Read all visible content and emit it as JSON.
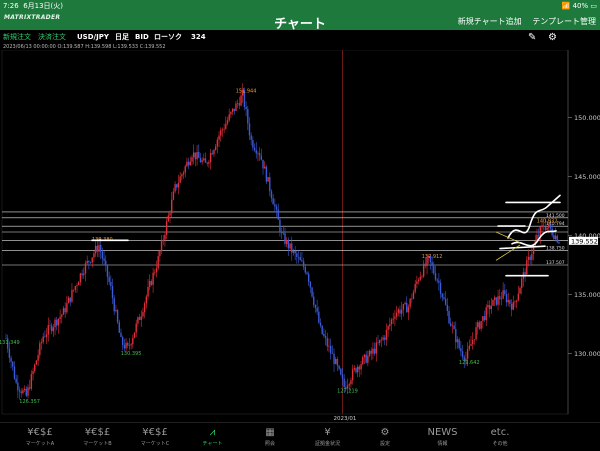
{
  "status": {
    "time": "7:26",
    "date": "6月13日(火)",
    "battery": "40%"
  },
  "header": {
    "logo": "MATRIXTRADER",
    "title": "チャート",
    "actions": [
      "新規チャート追加",
      "テンプレート管理"
    ]
  },
  "toolbar": {
    "new_order": "新規注文",
    "settle_order": "決済注文",
    "pair": "USD/JPY",
    "timeframe": "日足",
    "side": "BID",
    "chart_type": "ローソク",
    "bars": "324"
  },
  "ohlc": "2023/06/13 00:00:00  O:139.587  H:139.598  L:139.533  C:139.552",
  "chart_data": {
    "type": "candlestick",
    "pair": "USD/JPY",
    "y_ticks": [
      130.0,
      135.0,
      140.0,
      145.0,
      150.0
    ],
    "y_tick_labels": [
      "130.000",
      "135.000",
      "140.000",
      "145.000",
      "150.000"
    ],
    "x_labels": [
      "2023/01"
    ],
    "price_marks": [
      {
        "label": "151.944",
        "type": "high",
        "value": 151.944
      },
      {
        "label": "139.380",
        "type": "high",
        "value": 139.38
      },
      {
        "label": "137.912",
        "type": "high",
        "value": 137.912
      },
      {
        "label": "140.932",
        "type": "high",
        "value": 140.932
      },
      {
        "label": "131.349",
        "type": "low",
        "value": 131.349
      },
      {
        "label": "126.357",
        "type": "low",
        "value": 126.357
      },
      {
        "label": "130.395",
        "type": "low",
        "value": 130.395
      },
      {
        "label": "127.219",
        "type": "low",
        "value": 127.219
      },
      {
        "label": "129.642",
        "type": "low",
        "value": 129.642
      }
    ],
    "current_price": "139.552",
    "horizontal_lines": [
      {
        "label": "",
        "value": 142.0
      },
      {
        "label": "141.500",
        "value": 141.5
      },
      {
        "label": "140.794",
        "value": 140.794
      },
      {
        "label": "",
        "value": 140.3
      },
      {
        "label": "",
        "value": 139.6
      },
      {
        "label": "138.750",
        "value": 138.75
      },
      {
        "label": "137.507",
        "value": 137.507
      }
    ],
    "waypoints": [
      [
        0,
        131.3
      ],
      [
        6,
        127.5
      ],
      [
        12,
        126.4
      ],
      [
        22,
        131.5
      ],
      [
        34,
        133.5
      ],
      [
        45,
        137.0
      ],
      [
        55,
        139.2
      ],
      [
        62,
        135.5
      ],
      [
        68,
        131.0
      ],
      [
        72,
        130.4
      ],
      [
        80,
        133.5
      ],
      [
        90,
        138.0
      ],
      [
        100,
        144.0
      ],
      [
        110,
        147.0
      ],
      [
        118,
        146.0
      ],
      [
        126,
        148.5
      ],
      [
        134,
        150.5
      ],
      [
        140,
        151.9
      ],
      [
        145,
        148.0
      ],
      [
        150,
        147.0
      ],
      [
        158,
        143.0
      ],
      [
        163,
        140.0
      ],
      [
        170,
        138.5
      ],
      [
        178,
        137.0
      ],
      [
        186,
        132.0
      ],
      [
        194,
        129.5
      ],
      [
        200,
        127.2
      ],
      [
        208,
        129.0
      ],
      [
        216,
        130.0
      ],
      [
        224,
        131.5
      ],
      [
        230,
        133.5
      ],
      [
        238,
        134.0
      ],
      [
        244,
        136.5
      ],
      [
        250,
        137.9
      ],
      [
        256,
        136.0
      ],
      [
        262,
        133.0
      ],
      [
        268,
        130.5
      ],
      [
        272,
        129.6
      ],
      [
        278,
        132.0
      ],
      [
        286,
        134.0
      ],
      [
        294,
        135.0
      ],
      [
        300,
        134.0
      ],
      [
        308,
        137.5
      ],
      [
        314,
        139.8
      ],
      [
        318,
        140.9
      ],
      [
        322,
        140.5
      ],
      [
        327,
        139.6
      ]
    ]
  },
  "tabs": [
    {
      "icon": "¥€$£",
      "label": "マーケットA"
    },
    {
      "icon": "¥€$£",
      "label": "マーケットB"
    },
    {
      "icon": "¥€$£",
      "label": "マーケットC"
    },
    {
      "icon": "⩘",
      "label": "チャート"
    },
    {
      "icon": "▦",
      "label": "照会"
    },
    {
      "icon": "¥",
      "label": "証拠金状況"
    },
    {
      "icon": "⚙",
      "label": "設定"
    },
    {
      "icon": "NEWS",
      "label": "情報"
    },
    {
      "icon": "etc.",
      "label": "その他"
    }
  ]
}
